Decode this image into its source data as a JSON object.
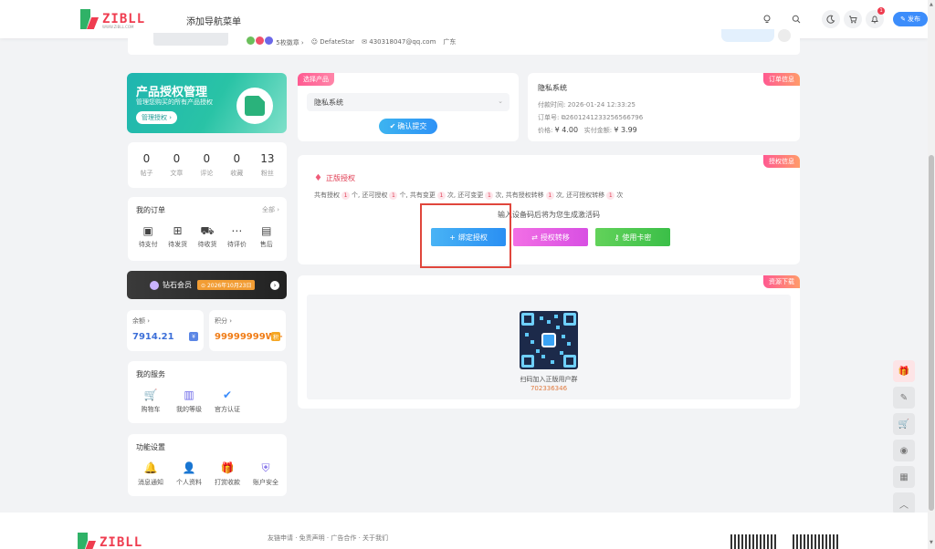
{
  "header": {
    "logo_text": "ZIBLL",
    "logo_sub": "WWW.ZIBLL.COM",
    "nav_label": "添加导航菜单",
    "notification_count": "1",
    "publish_label": "发布",
    "icons": [
      "bulb-icon",
      "search-icon",
      "moon-icon",
      "cart-icon",
      "bell-icon",
      "pencil-icon"
    ]
  },
  "profile": {
    "badges_label": "5枚徽章",
    "username": "DefateStar",
    "email": "430318047@qq.com",
    "region": "广东"
  },
  "promo": {
    "title": "产品授权管理",
    "subtitle": "管理您购买的所有产品授权",
    "button": "管理授权"
  },
  "stats": [
    {
      "num": "0",
      "label": "帖子"
    },
    {
      "num": "0",
      "label": "文章"
    },
    {
      "num": "0",
      "label": "评论"
    },
    {
      "num": "0",
      "label": "收藏"
    },
    {
      "num": "13",
      "label": "粉丝"
    }
  ],
  "orders": {
    "title": "我的订单",
    "more": "全部",
    "items": [
      {
        "label": "待支付",
        "icon": "wallet-icon"
      },
      {
        "label": "待发货",
        "icon": "box-icon"
      },
      {
        "label": "待收货",
        "icon": "truck-icon"
      },
      {
        "label": "待评价",
        "icon": "comment-icon"
      },
      {
        "label": "售后",
        "icon": "refund-icon"
      }
    ]
  },
  "vip": {
    "label": "钻石会员",
    "date": "2026年10月23日"
  },
  "wallet": {
    "balance_label": "余额",
    "balance": "7914.21",
    "points_label": "积分",
    "points": "99999999W+"
  },
  "services": {
    "title": "我的服务",
    "items": [
      {
        "label": "购物车",
        "icon": "cart-icon",
        "color": "#f08a2b"
      },
      {
        "label": "我的等级",
        "icon": "chart-icon",
        "color": "#6b67e8"
      },
      {
        "label": "官方认证",
        "icon": "verified-icon",
        "color": "#3c8dfb"
      }
    ]
  },
  "settings": {
    "title": "功能设置",
    "items": [
      {
        "label": "消息通知",
        "icon": "bell-icon",
        "color": "#f08a2b"
      },
      {
        "label": "个人资料",
        "icon": "user-icon",
        "color": "#3c8dfb"
      },
      {
        "label": "打赏收款",
        "icon": "gift-icon",
        "color": "#ef4f6b"
      },
      {
        "label": "账户安全",
        "icon": "shield-icon",
        "color": "#7a68e8"
      }
    ]
  },
  "product": {
    "tag": "选择产品",
    "selected": "隐私系统",
    "confirm": "确认提交"
  },
  "order_info": {
    "tag": "订单信息",
    "product": "隐私系统",
    "pay_time_label": "付款时间:",
    "pay_time": "2026-01-24 12:33:25",
    "order_no_label": "订单号:",
    "order_no": "2601241233256566796",
    "price_label": "价格:",
    "price": "¥ 4.00",
    "paid_label": "实付金额:",
    "paid": "¥ 3.99"
  },
  "license": {
    "tag": "授权信息",
    "title": "正版授权",
    "summary_parts": [
      "共有授权",
      "1",
      "个, 还可授权",
      "1",
      "个, 共有变更",
      "1",
      "次, 还可变更",
      "1",
      "次, 共有授权转移",
      "1",
      "次, 还可授权转移",
      "1",
      "次"
    ],
    "tip": "输入设备码后将为您生成激活码",
    "btn_bind": "绑定授权",
    "btn_transfer": "授权转移",
    "btn_card": "使用卡密"
  },
  "resource": {
    "tag": "资源下载",
    "caption": "扫码加入正版用户群",
    "group_number": "702336346"
  },
  "footer": {
    "links": "友链申请 · 免责声明 · 广告合作 · 关于我们"
  },
  "colors": {
    "accent": "#3c8dfb",
    "brand_red": "#ef3c4f",
    "brand_green": "#2fb267",
    "balance_blue": "#3c6fd8",
    "points_orange": "#f07d17"
  }
}
